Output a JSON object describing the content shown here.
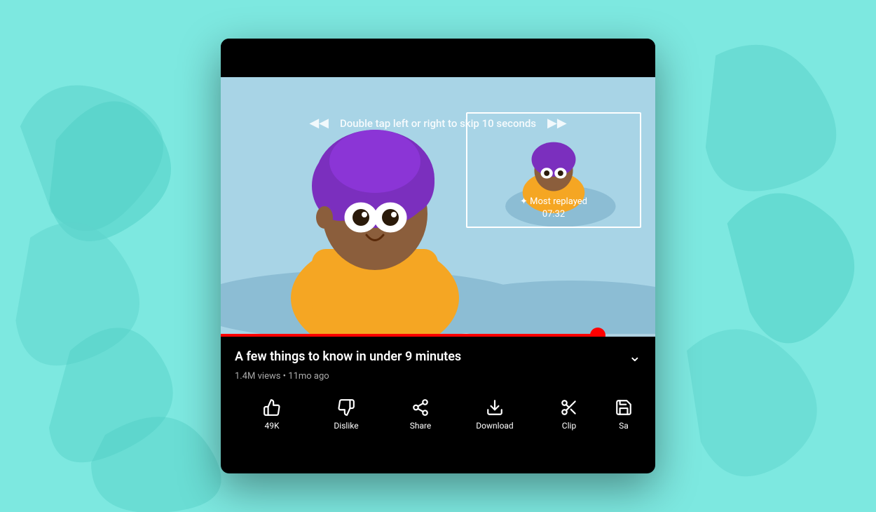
{
  "background": {
    "color": "#7de8e0"
  },
  "video": {
    "skip_hint": "Double tap left or right to skip 10 seconds",
    "most_replayed_label": "✦ Most replayed",
    "most_replayed_time": "07:32",
    "progress_percent": 87,
    "title": "A few things to know in under 9 minutes",
    "views": "1.4M views",
    "time_ago": "11mo ago",
    "meta": "1.4M views • 11mo ago"
  },
  "actions": [
    {
      "id": "like",
      "label": "49K",
      "icon": "👍"
    },
    {
      "id": "dislike",
      "label": "Dislike",
      "icon": "👎"
    },
    {
      "id": "share",
      "label": "Share",
      "icon": "share"
    },
    {
      "id": "download",
      "label": "Download",
      "icon": "download"
    },
    {
      "id": "clip",
      "label": "Clip",
      "icon": "clip"
    },
    {
      "id": "save",
      "label": "Sa...",
      "icon": "save"
    }
  ]
}
